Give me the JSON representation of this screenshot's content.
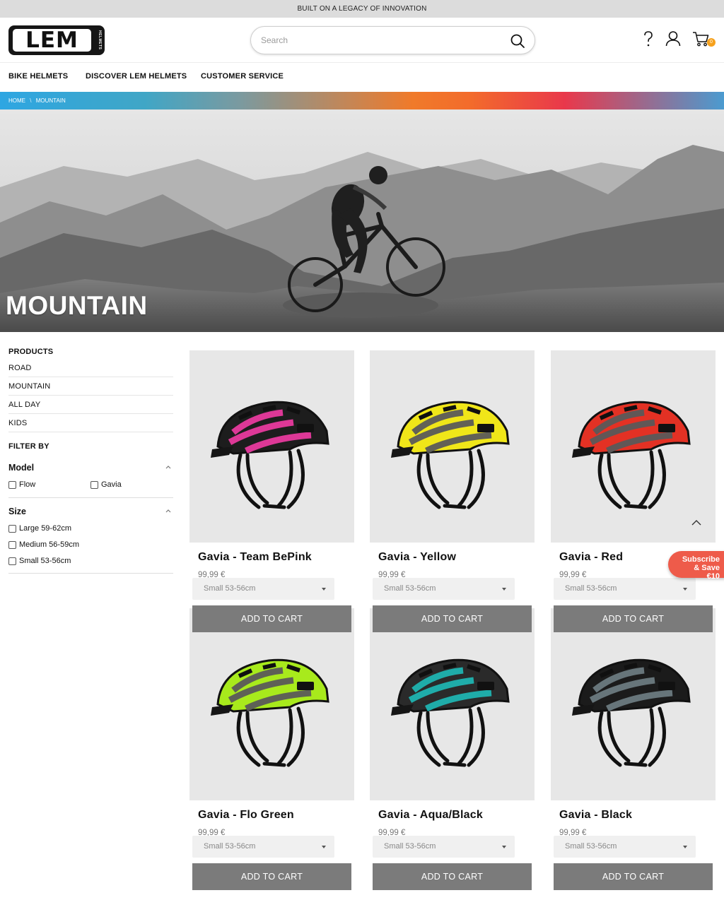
{
  "topbar": {
    "text": "BUILT ON A LEGACY OF INNOVATION"
  },
  "logo": {
    "text": "LEM",
    "sub": "HELMETS"
  },
  "search": {
    "placeholder": "Search"
  },
  "cart": {
    "count": "0"
  },
  "nav": {
    "items": [
      "BIKE HELMETS",
      "DISCOVER LEM HELMETS",
      "CUSTOMER SERVICE"
    ]
  },
  "breadcrumb": {
    "home": "HOME",
    "sep": "\\",
    "current": "MOUNTAIN"
  },
  "hero": {
    "title": "MOUNTAIN"
  },
  "sidebar": {
    "products_heading": "PRODUCTS",
    "products": [
      "ROAD",
      "MOUNTAIN",
      "ALL DAY",
      "KIDS"
    ],
    "filter_heading": "FILTER BY",
    "model": {
      "title": "Model",
      "options": [
        "Flow",
        "Gavia"
      ]
    },
    "size": {
      "title": "Size",
      "options": [
        "Large 59-62cm",
        "Medium 56-59cm",
        "Small 53-56cm"
      ]
    }
  },
  "products": [
    {
      "name": "Gavia - Team BePink",
      "price": "99,99 €",
      "size": "Small 53-56cm",
      "button": "ADD TO CART",
      "accent": "#e83a9e",
      "shell": "#1d1d1d"
    },
    {
      "name": "Gavia - Yellow",
      "price": "99,99 €",
      "size": "Small 53-56cm",
      "button": "ADD TO CART",
      "accent": "#5a5a5a",
      "shell": "#f0e619"
    },
    {
      "name": "Gavia - Red",
      "price": "99,99 €",
      "size": "Small 53-56cm",
      "button": "ADD TO CART",
      "accent": "#5a5a5a",
      "shell": "#e33124"
    },
    {
      "name": "Gavia - Flo Green",
      "price": "99,99 €",
      "size": "Small 53-56cm",
      "button": "ADD TO CART",
      "accent": "#5a5a5a",
      "shell": "#a8ea1c"
    },
    {
      "name": "Gavia - Aqua/Black",
      "price": "99,99 €",
      "size": "Small 53-56cm",
      "button": "ADD TO CART",
      "accent": "#1fb3b0",
      "shell": "#2a2a2a"
    },
    {
      "name": "Gavia - Black",
      "price": "99,99 €",
      "size": "Small 53-56cm",
      "button": "ADD TO CART",
      "accent": "#6c7a80",
      "shell": "#1b1b1b"
    }
  ],
  "subscribe": {
    "line1": "Subscribe",
    "line2": "& Save €10"
  }
}
